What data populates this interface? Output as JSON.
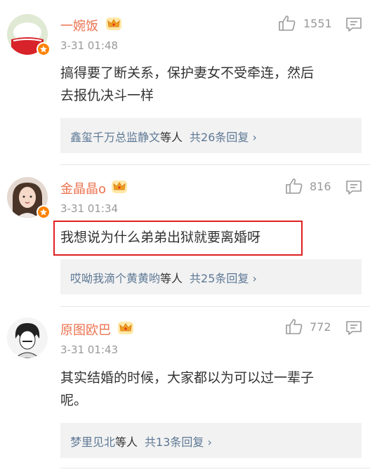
{
  "comments": [
    {
      "username": "一婉饭",
      "time": "3-31 01:48",
      "likes": "1551",
      "text_lines": [
        "搞得要了断关系，保护妻女不受牵连，然后",
        "去报仇决斗一样"
      ],
      "reply": {
        "name": "鑫玺千万总监静文",
        "mid": "等人",
        "count": "共26条回复 ›"
      }
    },
    {
      "username": "金晶晶o",
      "time": "3-31 01:34",
      "likes": "816",
      "text_lines": [
        "我想说为什么弟弟出狱就要离婚呀"
      ],
      "reply": {
        "name": "哎呦我滴个黄黄哟",
        "mid": "等人",
        "count": "共25条回复 ›"
      }
    },
    {
      "username": "原图欧巴",
      "time": "3-31 01:43",
      "likes": "772",
      "text_lines": [
        "其实结婚的时候，大家都以为可以过一辈子",
        "呢。"
      ],
      "reply": {
        "name": "梦里见北",
        "mid": "等人",
        "count": "共13条回复 ›"
      }
    }
  ],
  "icons": {
    "like": "thumbs-up-icon",
    "reply": "comment-icon",
    "crown": "crown-icon",
    "badge": "verified-badge-icon"
  },
  "colors": {
    "username": "#eb7350",
    "reply_link": "#5d7895",
    "highlight_border": "#e02020",
    "badge": "#ff8200",
    "muted": "#999999"
  }
}
